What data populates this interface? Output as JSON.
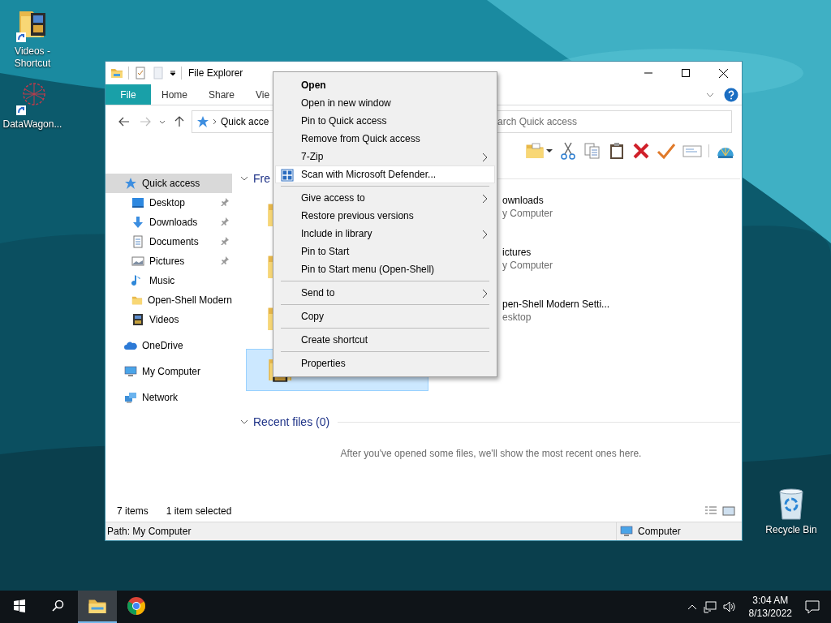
{
  "desktop_icons": [
    {
      "label": "Videos - Shortcut",
      "kind": "videos"
    },
    {
      "label": "DataWagon...",
      "kind": "app"
    },
    {
      "label": "Recycle Bin",
      "kind": "recycle"
    }
  ],
  "window": {
    "title": "File Explorer",
    "ribbon_tabs": [
      {
        "label": "File",
        "selected": true
      },
      {
        "label": "Home",
        "selected": false
      },
      {
        "label": "Share",
        "selected": false
      },
      {
        "label": "Vie",
        "selected": false
      }
    ],
    "address": "Quick acce",
    "search": {
      "placeholder": "arch Quick access"
    },
    "nav": [
      {
        "label": "Quick access",
        "kind": "star",
        "selected": true,
        "children": [
          {
            "label": "Desktop",
            "kind": "desktop",
            "pinned": true,
            "selected": false
          },
          {
            "label": "Downloads",
            "kind": "download",
            "pinned": true,
            "selected": false
          },
          {
            "label": "Documents",
            "kind": "document",
            "pinned": true,
            "selected": false
          },
          {
            "label": "Pictures",
            "kind": "pictures",
            "pinned": true,
            "selected": false
          },
          {
            "label": "Music",
            "kind": "music",
            "pinned": false,
            "selected": false
          },
          {
            "label": "Open-Shell Modern",
            "kind": "folder",
            "pinned": false,
            "selected": false
          },
          {
            "label": "Videos",
            "kind": "videos",
            "pinned": false,
            "selected": false
          }
        ]
      },
      {
        "label": "OneDrive",
        "kind": "cloud",
        "selected": false
      },
      {
        "label": "My Computer",
        "kind": "computer",
        "selected": false
      },
      {
        "label": "Network",
        "kind": "network",
        "selected": false
      }
    ],
    "frequent": {
      "title": "Fre",
      "left_tiles": [
        {
          "selected": false,
          "kind": "folder"
        },
        {
          "selected": false,
          "kind": "folder"
        },
        {
          "selected": false,
          "kind": "folder"
        },
        {
          "selected": true,
          "kind": "videos"
        }
      ],
      "items": [
        {
          "name": "ownloads",
          "location": "y Computer"
        },
        {
          "name": "ictures",
          "location": "y Computer"
        },
        {
          "name": "pen-Shell Modern Setti...",
          "location": "esktop"
        }
      ]
    },
    "recent": {
      "title": "Recent files (0)",
      "message": "After you've opened some files, we'll show the most recent ones here."
    },
    "status": {
      "count": "7 items",
      "selection": "1 item selected"
    },
    "status_bar": {
      "path": "Path: My Computer",
      "zone": "Computer"
    }
  },
  "context_menu": [
    {
      "kind": "command",
      "label": "Open",
      "bold": true,
      "submenu": false,
      "selected": false
    },
    {
      "kind": "command",
      "label": "Open in new window",
      "bold": false,
      "submenu": false,
      "selected": false
    },
    {
      "kind": "command",
      "label": "Pin to Quick access",
      "bold": false,
      "submenu": false,
      "selected": false
    },
    {
      "kind": "command",
      "label": "Remove from Quick access",
      "bold": false,
      "submenu": false,
      "selected": false
    },
    {
      "kind": "command",
      "label": "7-Zip",
      "bold": false,
      "submenu": true,
      "selected": false
    },
    {
      "kind": "scan",
      "label": "Scan with Microsoft Defender...",
      "bold": false,
      "submenu": false,
      "selected": true
    },
    {
      "kind": "separator"
    },
    {
      "kind": "command",
      "label": "Give access to",
      "bold": false,
      "submenu": true,
      "selected": false
    },
    {
      "kind": "command",
      "label": "Restore previous versions",
      "bold": false,
      "submenu": false,
      "selected": false
    },
    {
      "kind": "command",
      "label": "Include in library",
      "bold": false,
      "submenu": true,
      "selected": false
    },
    {
      "kind": "command",
      "label": "Pin to Start",
      "bold": false,
      "submenu": false,
      "selected": false
    },
    {
      "kind": "command",
      "label": "Pin to Start menu (Open-Shell)",
      "bold": false,
      "submenu": false,
      "selected": false
    },
    {
      "kind": "separator"
    },
    {
      "kind": "command",
      "label": "Send to",
      "bold": false,
      "submenu": true,
      "selected": false
    },
    {
      "kind": "separator"
    },
    {
      "kind": "command",
      "label": "Copy",
      "bold": false,
      "submenu": false,
      "selected": false
    },
    {
      "kind": "separator"
    },
    {
      "kind": "command",
      "label": "Create shortcut",
      "bold": false,
      "submenu": false,
      "selected": false
    },
    {
      "kind": "separator"
    },
    {
      "kind": "command",
      "label": "Properties",
      "bold": false,
      "submenu": false,
      "selected": false
    }
  ],
  "taskbar": {
    "apps": [
      {
        "kind": "start",
        "active": false
      },
      {
        "kind": "search",
        "active": false
      },
      {
        "kind": "explorer",
        "active": true
      },
      {
        "kind": "chrome",
        "active": false
      }
    ],
    "time": "3:04 AM",
    "date": "8/13/2022"
  }
}
